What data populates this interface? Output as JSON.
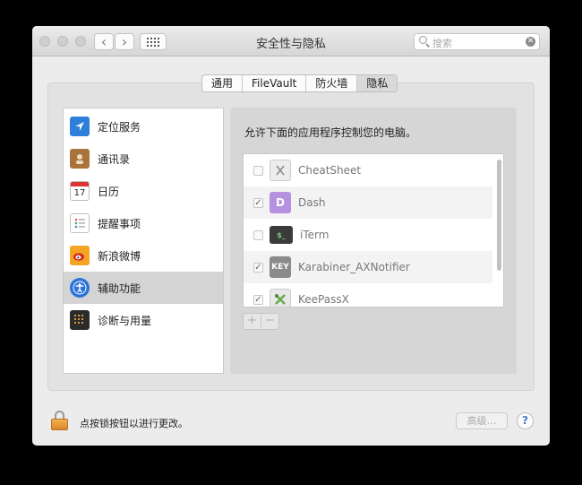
{
  "window": {
    "title": "安全性与隐私",
    "search_placeholder": "搜索",
    "nav_back": "‹",
    "nav_forward": "›"
  },
  "tabs": [
    {
      "label": "通用",
      "active": false
    },
    {
      "label": "FileVault",
      "active": false
    },
    {
      "label": "防火墙",
      "active": false
    },
    {
      "label": "隐私",
      "active": true
    }
  ],
  "categories": [
    {
      "label": "定位服务",
      "icon": "location-icon"
    },
    {
      "label": "通讯录",
      "icon": "contacts-icon"
    },
    {
      "label": "日历",
      "icon": "calendar-icon",
      "icon_text": "17"
    },
    {
      "label": "提醒事项",
      "icon": "reminders-icon"
    },
    {
      "label": "新浪微博",
      "icon": "weibo-icon"
    },
    {
      "label": "辅助功能",
      "icon": "accessibility-icon",
      "selected": true
    },
    {
      "label": "诊断与用量",
      "icon": "diagnostics-icon"
    }
  ],
  "content": {
    "prompt": "允许下面的应用程序控制您的电脑。",
    "apps": [
      {
        "name": "CheatSheet",
        "checked": false,
        "icon": "cheatsheet-icon"
      },
      {
        "name": "Dash",
        "checked": true,
        "icon": "dash-icon",
        "icon_text": "D"
      },
      {
        "name": "iTerm",
        "checked": false,
        "icon": "iterm-icon",
        "icon_text": "$_"
      },
      {
        "name": "Karabiner_AXNotifier",
        "checked": true,
        "icon": "karabiner-icon",
        "icon_text": "KEY"
      },
      {
        "name": "KeePassX",
        "checked": true,
        "icon": "keepassx-icon"
      }
    ],
    "add_label": "+",
    "remove_label": "−"
  },
  "footer": {
    "lock_label": "点按锁按钮以进行更改。",
    "advanced_label": "高级…",
    "help_label": "?"
  },
  "colors": {
    "selection": "#d4d4d4",
    "lock": "#e9a13f",
    "accessibility_blue": "#2a73d9"
  }
}
